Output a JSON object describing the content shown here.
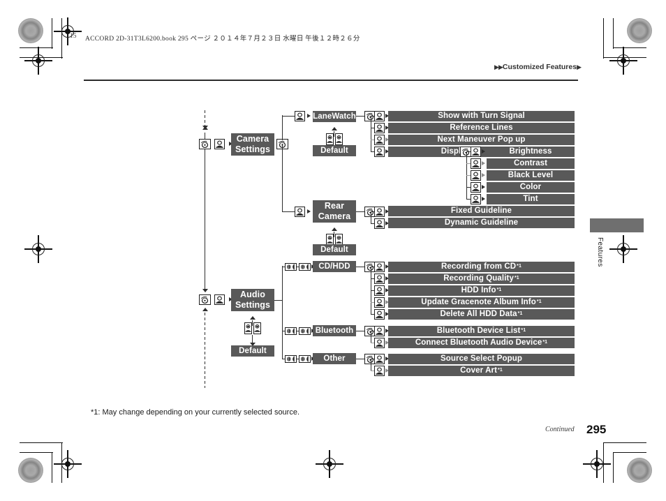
{
  "page": {
    "corner_number": "15",
    "file_stamp": "ACCORD 2D-31T3L6200.book   295 ページ   ２０１４年７月２３日   水曜日   午後１２時２６分",
    "running_head": "Customized Features",
    "tab_label": "Features",
    "footnote": "*1: May change depending on your currently selected source.",
    "continued": "Continued",
    "page_number": "295",
    "accent_fill": "#595959",
    "line_color": "#2d2d2d"
  },
  "diagram": {
    "branches": [
      {
        "id": "camera",
        "root_label": "Camera\nSettings",
        "root_line1": "Camera",
        "root_line2": "Settings",
        "default_label": "Default",
        "groups": [
          {
            "label": "LaneWatch",
            "default_label": "Default",
            "items": [
              {
                "label": "Show with Turn Signal",
                "note": ""
              },
              {
                "label": "Reference Lines",
                "note": ""
              },
              {
                "label": "Next Maneuver Pop up",
                "note": ""
              },
              {
                "label": "Display",
                "note": "",
                "children": [
                  {
                    "label": "Brightness",
                    "note": ""
                  },
                  {
                    "label": "Contrast",
                    "note": ""
                  },
                  {
                    "label": "Black Level",
                    "note": ""
                  },
                  {
                    "label": "Color",
                    "note": ""
                  },
                  {
                    "label": "Tint",
                    "note": ""
                  }
                ]
              }
            ]
          },
          {
            "label": "Rear\nCamera",
            "label_line1": "Rear",
            "label_line2": "Camera",
            "default_label": "Default",
            "items": [
              {
                "label": "Fixed Guideline",
                "note": ""
              },
              {
                "label": "Dynamic Guideline",
                "note": ""
              }
            ]
          }
        ]
      },
      {
        "id": "audio",
        "root_label": "Audio\nSettings",
        "root_line1": "Audio",
        "root_line2": "Settings",
        "default_label": "Default",
        "groups": [
          {
            "label": "CD/HDD",
            "items": [
              {
                "label": "Recording from CD",
                "note": "*1"
              },
              {
                "label": "Recording Quality",
                "note": "*1"
              },
              {
                "label": "HDD Info",
                "note": "*1"
              },
              {
                "label": "Update Gracenote Album Info",
                "note": "*1"
              },
              {
                "label": "Delete All HDD Data",
                "note": "*1"
              }
            ]
          },
          {
            "label": "Bluetooth",
            "items": [
              {
                "label": "Bluetooth Device List",
                "note": "*1"
              },
              {
                "label": "Connect Bluetooth Audio Device",
                "note": "*1"
              }
            ]
          },
          {
            "label": "Other",
            "items": [
              {
                "label": "Source Select Popup",
                "note": ""
              },
              {
                "label": "Cover Art",
                "note": "*1"
              }
            ]
          }
        ]
      }
    ],
    "icons": {
      "knob": "rotary-knob-icon",
      "enter": "enter-button-icon",
      "up": "up-button-icon",
      "down": "down-button-icon",
      "left": "left-button-icon",
      "right": "right-button-icon"
    }
  }
}
